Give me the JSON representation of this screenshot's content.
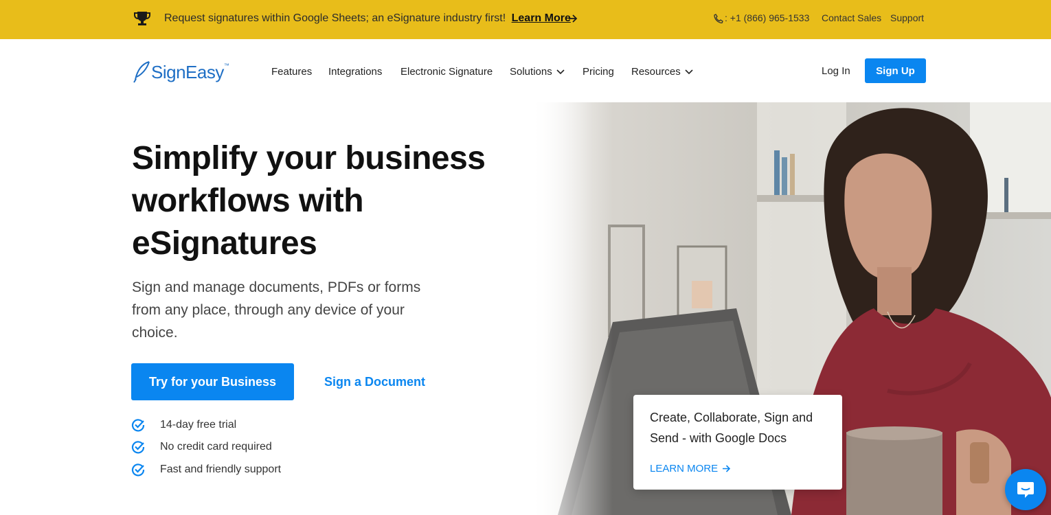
{
  "announcement": {
    "text": "Request signatures within Google Sheets; an eSignature industry first!",
    "link": "Learn More",
    "phone": ": +1 (866) 965-1533",
    "contact_sales": "Contact Sales",
    "support": "Support"
  },
  "brand": {
    "name": "SignEasy",
    "tm": "™",
    "accent": "#0a86f0",
    "bar_color": "#e8bd1a"
  },
  "nav": {
    "items": [
      "Features",
      "Integrations",
      "Electronic Signature",
      "Solutions",
      "Pricing",
      "Resources"
    ],
    "login": "Log In",
    "signup": "Sign Up"
  },
  "hero": {
    "title": "Simplify your business workflows with eSignatures",
    "subtitle": "Sign and manage documents, PDFs or forms from any place, through any device of your choice.",
    "primary_cta": "Try for your Business",
    "secondary_cta": "Sign a Document",
    "checks": [
      "14-day free trial",
      "No credit card required",
      "Fast and friendly support"
    ]
  },
  "card": {
    "text": "Create, Collaborate, Sign and Send - with Google Docs",
    "link": "LEARN MORE"
  },
  "icons": [
    "trophy-icon",
    "arrow-right-icon",
    "phone-icon",
    "chevron-down-icon",
    "check-circle-icon",
    "chat-icon"
  ]
}
